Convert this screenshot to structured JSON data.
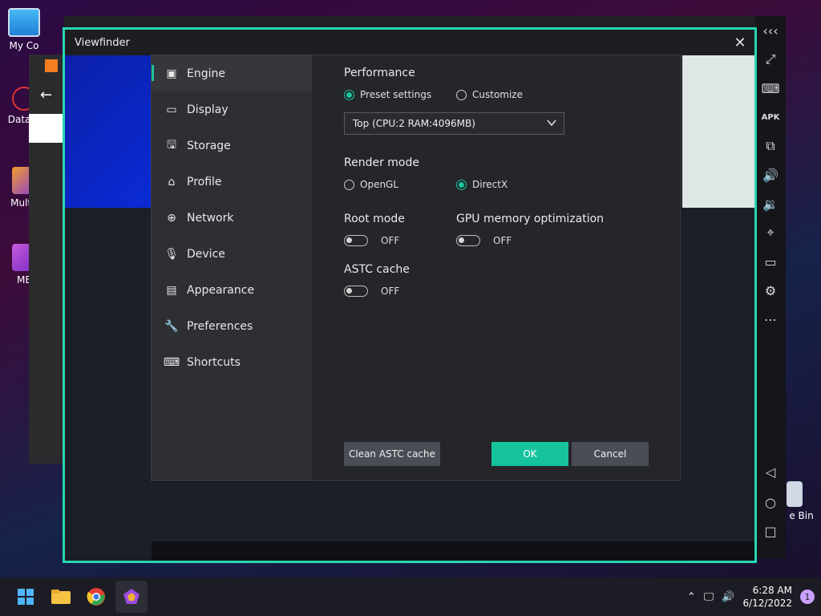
{
  "desktop": {
    "icons": [
      {
        "label": "My Co"
      },
      {
        "label": "DataW"
      },
      {
        "label": "Multi-"
      },
      {
        "label": "ME"
      }
    ],
    "recycle_label": "e Bin"
  },
  "viewfinder": {
    "title": "Viewfinder",
    "close_glyph": "✕"
  },
  "settings": {
    "nav": [
      {
        "label": "Engine",
        "icon": "chip-icon"
      },
      {
        "label": "Display",
        "icon": "monitor-icon"
      },
      {
        "label": "Storage",
        "icon": "save-icon"
      },
      {
        "label": "Profile",
        "icon": "tag-icon"
      },
      {
        "label": "Network",
        "icon": "globe-icon"
      },
      {
        "label": "Device",
        "icon": "microphone-icon"
      },
      {
        "label": "Appearance",
        "icon": "window-icon"
      },
      {
        "label": "Preferences",
        "icon": "wrench-icon"
      },
      {
        "label": "Shortcuts",
        "icon": "keyboard-icon"
      }
    ],
    "performance": {
      "title": "Performance",
      "preset_label": "Preset settings",
      "customize_label": "Customize",
      "selected": "preset",
      "dropdown_value": "Top (CPU:2 RAM:4096MB)"
    },
    "render_mode": {
      "title": "Render mode",
      "opengl_label": "OpenGL",
      "directx_label": "DirectX",
      "selected": "directx"
    },
    "root_mode": {
      "title": "Root mode",
      "state": "OFF"
    },
    "gpu_opt": {
      "title": "GPU memory optimization",
      "state": "OFF"
    },
    "astc": {
      "title": "ASTC cache",
      "state": "OFF"
    },
    "buttons": {
      "clean": "Clean ASTC cache",
      "ok": "OK",
      "cancel": "Cancel"
    }
  },
  "taskbar": {
    "time": "6:28 AM",
    "date": "6/12/2022",
    "notifications": "1"
  },
  "colors": {
    "accent": "#17c39c",
    "frame": "#29d6b2"
  }
}
